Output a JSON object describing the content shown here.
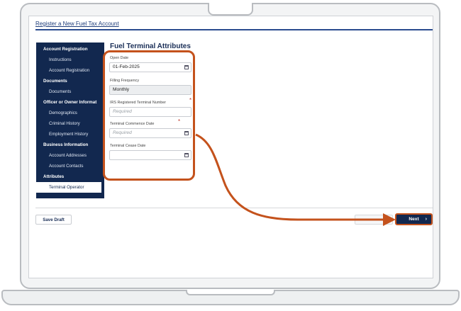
{
  "page": {
    "title": "Register a New Fuel Tax Account"
  },
  "sidebar": {
    "items": [
      {
        "label": "Account Registration",
        "type": "section"
      },
      {
        "label": "Instructions",
        "type": "sub"
      },
      {
        "label": "Account Registration",
        "type": "sub"
      },
      {
        "label": "Documents",
        "type": "section"
      },
      {
        "label": "Documents",
        "type": "sub"
      },
      {
        "label": "Officer or Owner Informat",
        "type": "section"
      },
      {
        "label": "Demographics",
        "type": "sub"
      },
      {
        "label": "Criminal History",
        "type": "sub"
      },
      {
        "label": "Employment History",
        "type": "sub"
      },
      {
        "label": "Business Information",
        "type": "section"
      },
      {
        "label": "Account Addresses",
        "type": "sub"
      },
      {
        "label": "Account Contacts",
        "type": "sub"
      },
      {
        "label": "Attributes",
        "type": "section"
      },
      {
        "label": "Terminal Operator",
        "type": "active"
      }
    ]
  },
  "form": {
    "heading": "Fuel Terminal Attributes",
    "open_date": {
      "label": "Open Date",
      "value": "01-Feb-2025"
    },
    "filing_frequency": {
      "label": "Filling Frequency",
      "value": "Monthly"
    },
    "irs_number": {
      "label": "IRS Registered Terminal Number",
      "placeholder": "Required",
      "required_mark": "*"
    },
    "commence_date": {
      "label": "Terminal Commence Date",
      "placeholder": "Required",
      "required_mark": "*"
    },
    "cease_date": {
      "label": "Terminal Cease Date",
      "value": ""
    }
  },
  "footer": {
    "save_label": "Save Draft",
    "next_label": "Next",
    "next_chevron": "›"
  },
  "colors": {
    "navy": "#12284f",
    "accent": "#c4521c",
    "link": "#1f3d7a"
  },
  "icons": {
    "calendar": "calendar-icon",
    "next": "chevron-right-icon"
  }
}
